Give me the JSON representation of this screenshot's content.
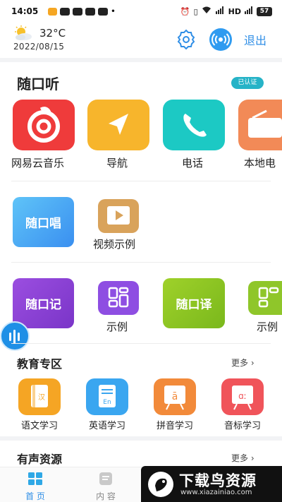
{
  "status_bar": {
    "time": "14:05",
    "network": "HD",
    "battery": "57"
  },
  "header": {
    "temperature": "32°C",
    "date": "2022/08/15",
    "weather_icon": "partly-sunny-icon",
    "logout_label": "退出"
  },
  "sections": {
    "listen_title": "随口听",
    "verified_badge": "已认证",
    "education_title": "教育专区",
    "education_more": "更多 ›",
    "audio_title": "有声资源",
    "audio_more": "更多 ›"
  },
  "listen_apps": [
    {
      "label": "网易云音乐",
      "icon": "netease-music-icon",
      "color": "#ef3b3b"
    },
    {
      "label": "导航",
      "icon": "navigation-arrow-icon",
      "color": "#f7b52c"
    },
    {
      "label": "电话",
      "icon": "phone-icon",
      "color": "#1cc9c4"
    },
    {
      "label": "本地电",
      "icon": "radio-icon",
      "color": "#f28a57"
    }
  ],
  "sing_row": {
    "sing_button": "随口唱",
    "video_label": "视频示例"
  },
  "note_row": {
    "note_button": "随口记",
    "example_label": "示例",
    "translate_button": "随口译",
    "example2_label": "示例"
  },
  "education": [
    {
      "label": "语文学习",
      "icon_text": "汉",
      "color": "#f5a524"
    },
    {
      "label": "英语学习",
      "icon_text": "En",
      "color": "#3aa6f0"
    },
    {
      "label": "拼音学习",
      "icon_text": "ā",
      "color": "#f28a3a"
    },
    {
      "label": "音标学习",
      "icon_text": "ɑː",
      "color": "#f0545a"
    }
  ],
  "tabbar": {
    "home": "首 页",
    "content": "内 容"
  },
  "watermark": {
    "title": "下载鸟资源",
    "url": "www.xiazainiao.com"
  },
  "colors": {
    "accent": "#2f8ee6",
    "verified": "#26b3c7"
  }
}
